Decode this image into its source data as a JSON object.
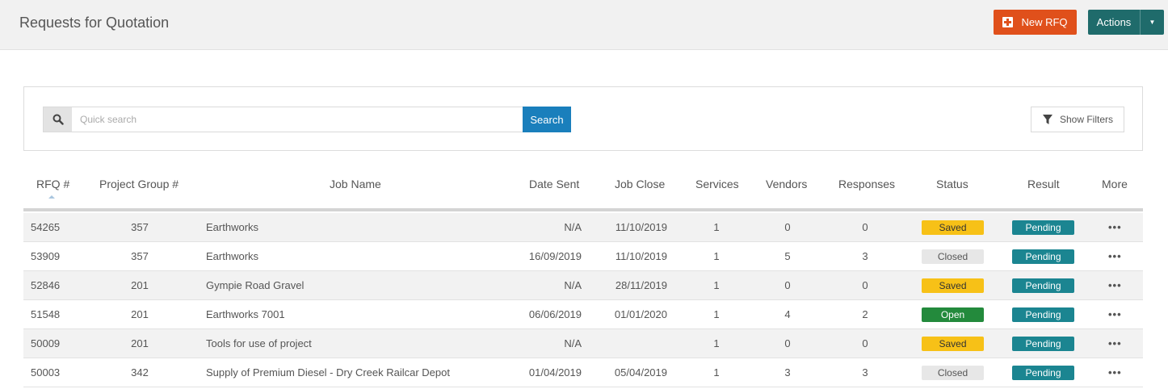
{
  "header": {
    "title": "Requests for Quotation",
    "new_label": "New RFQ",
    "actions_label": "Actions",
    "caret": "▼"
  },
  "search": {
    "placeholder": "Quick search",
    "value": "",
    "button_label": "Search",
    "filters_label": "Show Filters"
  },
  "table": {
    "columns": [
      "RFQ #",
      "Project Group #",
      "Job Name",
      "Date Sent",
      "Job Close",
      "Services",
      "Vendors",
      "Responses",
      "Status",
      "Result",
      "More"
    ],
    "sorted_by": "RFQ #",
    "rows": [
      {
        "rfq": "54265",
        "group": "357",
        "job": "Earthworks",
        "sent": "N/A",
        "close": "11/10/2019",
        "services": "1",
        "vendors": "0",
        "responses": "0",
        "status": "Saved",
        "result": "Pending",
        "more": "•••"
      },
      {
        "rfq": "53909",
        "group": "357",
        "job": "Earthworks",
        "sent": "16/09/2019",
        "close": "11/10/2019",
        "services": "1",
        "vendors": "5",
        "responses": "3",
        "status": "Closed",
        "result": "Pending",
        "more": "•••"
      },
      {
        "rfq": "52846",
        "group": "201",
        "job": "Gympie Road Gravel",
        "sent": "N/A",
        "close": "28/11/2019",
        "services": "1",
        "vendors": "0",
        "responses": "0",
        "status": "Saved",
        "result": "Pending",
        "more": "•••"
      },
      {
        "rfq": "51548",
        "group": "201",
        "job": "Earthworks 7001",
        "sent": "06/06/2019",
        "close": "01/01/2020",
        "services": "1",
        "vendors": "4",
        "responses": "2",
        "status": "Open",
        "result": "Pending",
        "more": "•••"
      },
      {
        "rfq": "50009",
        "group": "201",
        "job": "Tools for use of project",
        "sent": "N/A",
        "close": "",
        "services": "1",
        "vendors": "0",
        "responses": "0",
        "status": "Saved",
        "result": "Pending",
        "more": "•••"
      },
      {
        "rfq": "50003",
        "group": "342",
        "job": "Supply of Premium Diesel - Dry Creek Railcar Depot",
        "sent": "01/04/2019",
        "close": "05/04/2019",
        "services": "1",
        "vendors": "3",
        "responses": "3",
        "status": "Closed",
        "result": "Pending",
        "more": "•••"
      }
    ]
  },
  "colors": {
    "new_button": "#e0501b",
    "actions_button": "#1f6b6b",
    "search_button": "#1a7fbc",
    "status": {
      "Saved": {
        "bg": "#f7c117",
        "fg": "#333333"
      },
      "Closed": {
        "bg": "#e7e7e7",
        "fg": "#555555"
      },
      "Open": {
        "bg": "#238a3c",
        "fg": "#ffffff"
      }
    },
    "result": {
      "Pending": {
        "bg": "#1b8591",
        "fg": "#ffffff"
      }
    }
  },
  "icons": {
    "new": "plus-square-icon",
    "actions_caret": "caret-down-icon",
    "search": "search-icon",
    "filters": "filter-icon",
    "sort": "sort-asc-icon",
    "more": "ellipsis-icon"
  }
}
